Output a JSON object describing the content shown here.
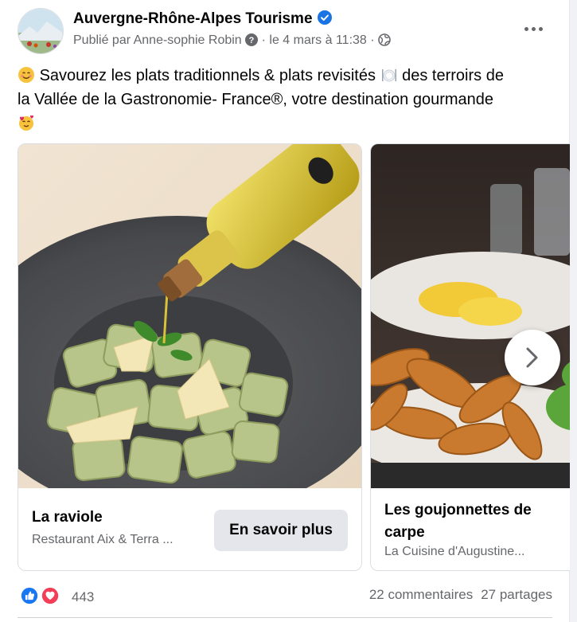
{
  "post": {
    "page_name": "Auvergne-Rhône-Alpes Tourisme",
    "published_by": "Publié par Anne-sophie Robin",
    "date": "· le 4 mars à 11:38 ·",
    "text_line1": "Savourez les plats traditionnels & plats revisités",
    "text_line1b": "des terroirs de",
    "text_line2": "la Vallée de la Gastronomie- France®, votre destination gourmande",
    "emojis": [
      "smiling-face-icon",
      "plate-cutlery-icon",
      "smiling-face-hearts-icon"
    ]
  },
  "cards": [
    {
      "title": "La raviole",
      "subtitle": "Restaurant Aix & Terra ...",
      "cta": "En savoir plus"
    },
    {
      "title": "Les goujonnettes de carpe",
      "subtitle": "La Cuisine d'Augustine..."
    }
  ],
  "footer": {
    "reaction_count": "443",
    "comments": "22 commentaires",
    "shares": "27 partages"
  },
  "colors": {
    "verified_blue": "#1b74e4",
    "secondary_text": "#65676b",
    "button_gray": "#e4e6eb",
    "like_blue": "#1877f2",
    "love_red": "#f33e58"
  }
}
